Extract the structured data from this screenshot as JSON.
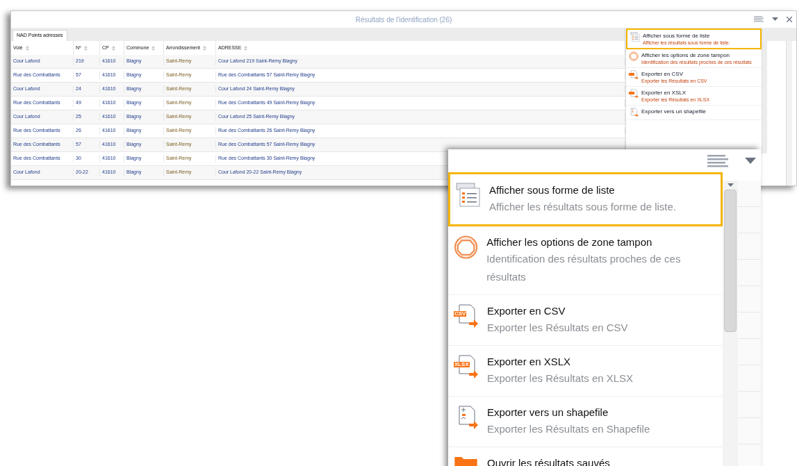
{
  "window": {
    "title": "Résultats de l'identification (26)"
  },
  "tabs": [
    {
      "label": "NAD Points adresses",
      "selected": true
    }
  ],
  "table": {
    "columns": [
      "Voie",
      "Nº",
      "CP",
      "Commune",
      "Arrondissement",
      "ADRESSE"
    ],
    "rows": [
      [
        "Cour Lafond",
        "219",
        "41610",
        "Blagny",
        "Saint-Remy",
        "Cour Lafond 219 Saint-Remy Blagny"
      ],
      [
        "Rue des Combattants",
        "57",
        "41610",
        "Blagny",
        "Saint-Remy",
        "Rue des Combattants 57 Saint-Remy Blagny"
      ],
      [
        "Cour Lafond",
        "24",
        "41610",
        "Blagny",
        "Saint-Remy",
        "Cour Lafond 24 Saint-Remy Blagny"
      ],
      [
        "Rue des Combattants",
        "49",
        "41610",
        "Blagny",
        "Saint-Remy",
        "Rue des Combattants 49 Saint-Remy Blagny"
      ],
      [
        "Cour Lafond",
        "25",
        "41610",
        "Blagny",
        "Saint-Remy",
        "Cour Lafond 25 Saint-Remy Blagny"
      ],
      [
        "Rue des Combattants",
        "26",
        "41610",
        "Blagny",
        "Saint-Remy",
        "Rue des Combattants 26 Saint-Remy Blagny"
      ],
      [
        "Rue des Combattants",
        "57",
        "41610",
        "Blagny",
        "Saint-Remy",
        "Rue des Combattants 57 Saint-Remy Blagny"
      ],
      [
        "Rue des Combattants",
        "30",
        "41610",
        "Blagny",
        "Saint-Remy",
        "Rue des Combattants 30 Saint-Remy Blagny"
      ],
      [
        "Cour Lafond",
        "20-22",
        "41610",
        "Blagny",
        "Saint-Remy",
        "Cour Lafond 20-22 Saint-Remy Blagny"
      ]
    ]
  },
  "mini_menu": [
    {
      "kind": "list",
      "title": "Afficher sous forme de liste",
      "description": "Afficher les résultats sous forme de liste.",
      "selected": true
    },
    {
      "kind": "buffer",
      "title": "Afficher les options de zone tampon",
      "description": "Identification des résultats proches de ces résultats",
      "selected": false
    },
    {
      "kind": "csv",
      "title": "Exporter en CSV",
      "description": "Exporter les Résultats en CSV",
      "selected": false
    },
    {
      "kind": "xlsx",
      "title": "Exporter en XSLX",
      "description": "Exporter les Résultats en XLSX",
      "selected": false
    },
    {
      "kind": "shapefile",
      "title": "Exporter vers un shapefile",
      "selected": false
    }
  ],
  "zoom_menu": [
    {
      "kind": "list",
      "title": "Afficher sous forme de liste",
      "description": "Afficher les résultats sous forme de liste.",
      "selected": true
    },
    {
      "kind": "buffer",
      "title": "Afficher les options de zone tampon",
      "description": "Identification des résultats proches de ces résultats",
      "selected": false
    },
    {
      "kind": "csv",
      "badge": "CSV",
      "title": "Exporter en CSV",
      "description": "Exporter les Résultats en CSV",
      "selected": false
    },
    {
      "kind": "xlsx",
      "badge": "XLSX",
      "title": "Exporter en XSLX",
      "description": "Exporter les Résultats en XLSX",
      "selected": false
    },
    {
      "kind": "shapefile",
      "title": "Exporter vers un shapefile",
      "description": "Exporter les Résultats en Shapefile",
      "selected": false
    },
    {
      "kind": "folder",
      "title": "Ouvrir les résultats sauvés",
      "selected": false
    }
  ]
}
